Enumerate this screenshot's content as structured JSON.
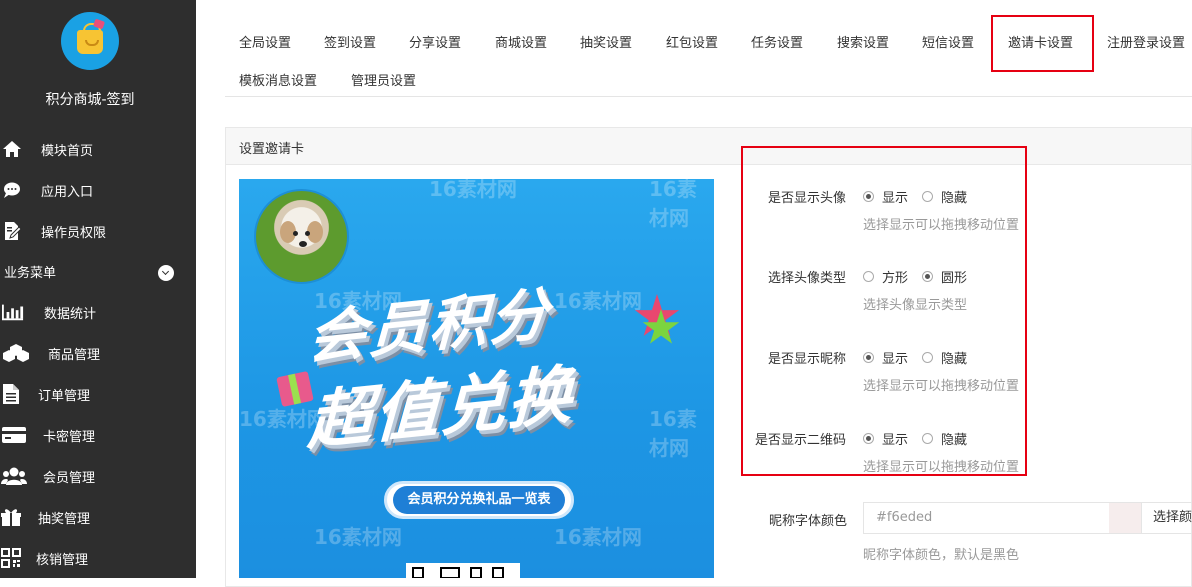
{
  "sidebar": {
    "app_title": "积分商城-签到",
    "items": [
      {
        "label": "模块首页",
        "icon": "home-icon"
      },
      {
        "label": "应用入口",
        "icon": "chat-icon"
      },
      {
        "label": "操作员权限",
        "icon": "edit-doc-icon"
      }
    ],
    "section_title": "业务菜单",
    "biz_items": [
      {
        "label": "数据统计",
        "icon": "bar-chart-icon"
      },
      {
        "label": "商品管理",
        "icon": "cubes-icon"
      },
      {
        "label": "订单管理",
        "icon": "document-icon"
      },
      {
        "label": "卡密管理",
        "icon": "credit-card-icon"
      },
      {
        "label": "会员管理",
        "icon": "users-icon"
      },
      {
        "label": "抽奖管理",
        "icon": "gift-icon"
      },
      {
        "label": "核销管理",
        "icon": "qrcode-icon"
      }
    ]
  },
  "tabs": [
    "全局设置",
    "签到设置",
    "分享设置",
    "商城设置",
    "抽奖设置",
    "红包设置",
    "任务设置",
    "搜索设置",
    "短信设置",
    "邀请卡设置",
    "注册登录设置",
    "模板消息设置",
    "管理员设置"
  ],
  "active_tab": "邀请卡设置",
  "panel": {
    "title": "设置邀请卡"
  },
  "poster": {
    "headline_line1": "会员积分",
    "headline_line2": "超值兑换",
    "ribbon": "会员积分兑换礼品一览表",
    "watermark": "16素材网"
  },
  "settings": {
    "show_avatar": {
      "label": "是否显示头像",
      "opt1": "显示",
      "opt2": "隐藏",
      "selected": "显示",
      "hint": "选择显示可以拖拽移动位置"
    },
    "avatar_type": {
      "label": "选择头像类型",
      "opt1": "方形",
      "opt2": "圆形",
      "selected": "圆形",
      "hint": "选择头像显示类型"
    },
    "show_nickname": {
      "label": "是否显示昵称",
      "opt1": "显示",
      "opt2": "隐藏",
      "selected": "显示",
      "hint": "选择显示可以拖拽移动位置"
    },
    "show_qrcode": {
      "label": "是否显示二维码",
      "opt1": "显示",
      "opt2": "隐藏",
      "selected": "显示",
      "hint": "选择显示可以拖拽移动位置"
    },
    "nickname_color": {
      "label": "昵称字体颜色",
      "value": "#f6eded",
      "button": "选择颜色",
      "hint": "昵称字体颜色，默认是黑色"
    }
  },
  "colors": {
    "sidebar_bg": "#2e2e2e",
    "highlight": "#e60012",
    "poster_blue": "#1d96e4"
  }
}
